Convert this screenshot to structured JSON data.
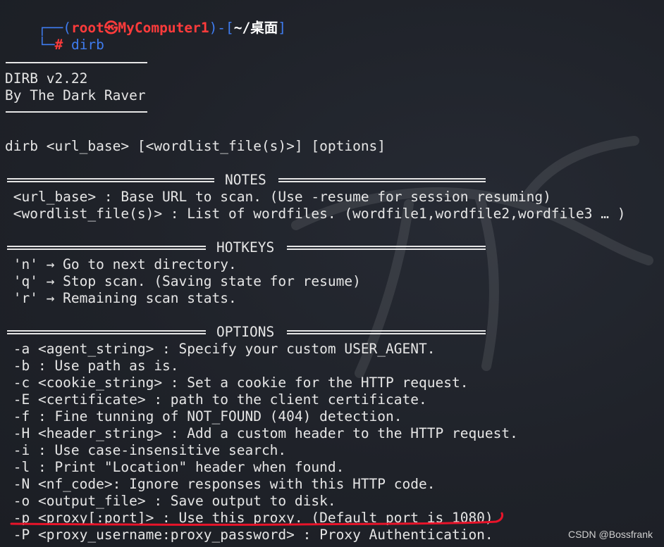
{
  "prompt": {
    "user": "root",
    "skull_glyph": "㉿",
    "host": "MyComputer1",
    "dir": "~/桌面",
    "command": "dirb"
  },
  "banner": {
    "version": "DIRB v2.22",
    "author": "By The Dark Raver"
  },
  "usage": "dirb <url_base> [<wordlist_file(s)>] [options]",
  "sections": {
    "notes": {
      "title": "NOTES",
      "lines": [
        " <url_base> : Base URL to scan. (Use -resume for session resuming)",
        " <wordlist_file(s)> : List of wordfiles. (wordfile1,wordfile2,wordfile3 … )"
      ]
    },
    "hotkeys": {
      "title": "HOTKEYS",
      "lines": [
        " 'n' → Go to next directory.",
        " 'q' → Stop scan. (Saving state for resume)",
        " 'r' → Remaining scan stats."
      ]
    },
    "options": {
      "title": "OPTIONS",
      "lines": [
        " -a <agent_string> : Specify your custom USER_AGENT.",
        " -b : Use path as is.",
        " -c <cookie_string> : Set a cookie for the HTTP request.",
        " -E <certificate> : path to the client certificate.",
        " -f : Fine tunning of NOT_FOUND (404) detection.",
        " -H <header_string> : Add a custom header to the HTTP request.",
        " -i : Use case-insensitive search.",
        " -l : Print \"Location\" header when found.",
        " -N <nf_code>: Ignore responses with this HTTP code.",
        " -o <output_file> : Save output to disk.",
        " -p <proxy[:port]> : Use this proxy. (Default port is 1080)",
        " -P <proxy_username:proxy_password> : Proxy Authentication."
      ]
    }
  },
  "watermark": "CSDN @Bossfrank",
  "colors": {
    "background": "#1f2229",
    "text": "#e6e6e6",
    "prompt_blue": "#3f7cf0",
    "prompt_red": "#ff3b3b",
    "annotation_underline": "#e8142a"
  }
}
